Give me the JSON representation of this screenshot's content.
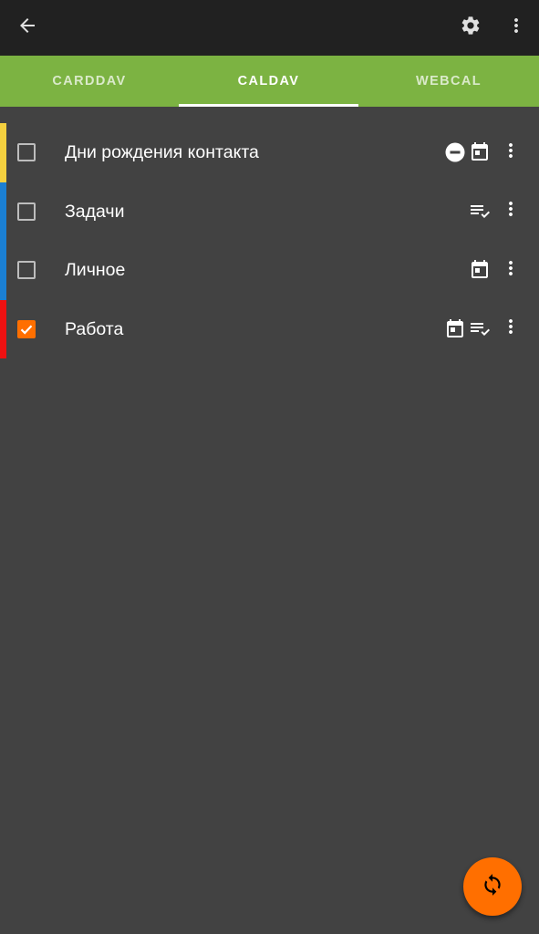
{
  "toolbar": {
    "back_icon": "arrow-back-icon",
    "settings_icon": "gear-icon",
    "overflow_icon": "more-vert-icon"
  },
  "tabs": [
    {
      "label": "CARDDAV",
      "active": false
    },
    {
      "label": "CALDAV",
      "active": true
    },
    {
      "label": "WEBCAL",
      "active": false
    }
  ],
  "collections": [
    {
      "label": "Дни рождения контакта",
      "color": "#f4d03f",
      "checked": false,
      "icons": [
        "read-only-icon",
        "calendar-icon"
      ]
    },
    {
      "label": "Задачи",
      "color": "#1b7fd3",
      "checked": false,
      "icons": [
        "tasks-icon"
      ]
    },
    {
      "label": "Личное",
      "color": "#1b7fd3",
      "checked": false,
      "icons": [
        "calendar-icon"
      ]
    },
    {
      "label": "Работа",
      "color": "#ee1111",
      "checked": true,
      "icons": [
        "calendar-icon",
        "tasks-icon"
      ]
    }
  ],
  "fab": {
    "icon": "sync-icon"
  },
  "colors": {
    "toolbar": "#212121",
    "tab_bar": "#7cb342",
    "background": "#424242",
    "accent": "#ff6f00"
  }
}
